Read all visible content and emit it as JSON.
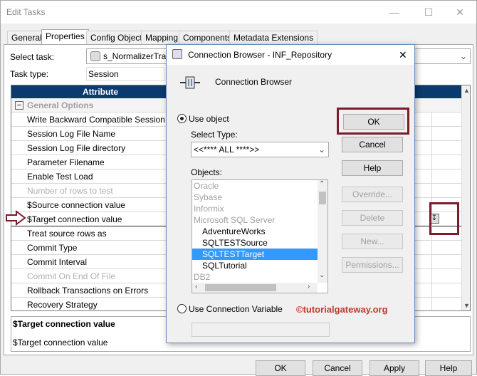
{
  "window": {
    "title": "Edit Tasks",
    "minimize": "—",
    "maximize": "☐",
    "close": "✕"
  },
  "tabs": [
    "General",
    "Properties",
    "Config Object",
    "Mapping",
    "Components",
    "Metadata Extensions"
  ],
  "task": {
    "select_label": "Select task:",
    "select_value": "s_NormalizerTran",
    "type_label": "Task type:",
    "type_value": "Session"
  },
  "grid": {
    "header": "Attribute",
    "group": "General Options",
    "group_toggle": "−",
    "rows": [
      {
        "label": "Write Backward Compatible Session Log",
        "disabled": false
      },
      {
        "label": "Session Log File Name",
        "disabled": false
      },
      {
        "label": "Session Log File directory",
        "disabled": false
      },
      {
        "label": "Parameter Filename",
        "disabled": false
      },
      {
        "label": "Enable Test Load",
        "disabled": false
      },
      {
        "label": "Number of rows to test",
        "disabled": true
      },
      {
        "label": "$Source connection value",
        "disabled": false
      },
      {
        "label": "$Target connection value",
        "disabled": false
      },
      {
        "label": "Treat source rows as",
        "disabled": false
      },
      {
        "label": "Commit Type",
        "disabled": false
      },
      {
        "label": "Commit Interval",
        "disabled": false
      },
      {
        "label": "Commit On End Of File",
        "disabled": true
      },
      {
        "label": "Rollback Transactions on Errors",
        "disabled": false
      },
      {
        "label": "Recovery Strategy",
        "disabled": false
      }
    ]
  },
  "description": {
    "title": "$Target connection value",
    "text": "$Target connection value"
  },
  "bottom_buttons": [
    "OK",
    "Cancel",
    "Apply",
    "Help"
  ],
  "dialog": {
    "title": "Connection Browser - INF_Repository",
    "close": "✕",
    "heading": "Connection Browser",
    "use_object": "Use object",
    "select_type_label": "Select Type:",
    "select_type_value": "<<**** ALL ****>>",
    "objects_label": "Objects:",
    "objects": [
      {
        "label": "Oracle",
        "kind": "grey"
      },
      {
        "label": "Sybase",
        "kind": "grey"
      },
      {
        "label": "Informix",
        "kind": "grey"
      },
      {
        "label": "Microsoft SQL Server",
        "kind": "grey"
      },
      {
        "label": "AdventureWorks",
        "kind": "indent"
      },
      {
        "label": "SQLTESTSource",
        "kind": "indent"
      },
      {
        "label": "SQLTESTTarget",
        "kind": "selected"
      },
      {
        "label": "SQLTutorial",
        "kind": "indent"
      },
      {
        "label": "DB2",
        "kind": "grey"
      }
    ],
    "use_variable": "Use Connection Variable",
    "buttons": {
      "ok": "OK",
      "cancel": "Cancel",
      "help": "Help",
      "override": "Override...",
      "delete": "Delete",
      "new": "New...",
      "permissions": "Permissions..."
    },
    "watermark": "©tutorialgateway.org"
  },
  "colors": {
    "grid_header": "#0b3a6e",
    "highlight": "#7a1c2c",
    "selection": "#3399ff",
    "watermark": "#c0392b"
  }
}
